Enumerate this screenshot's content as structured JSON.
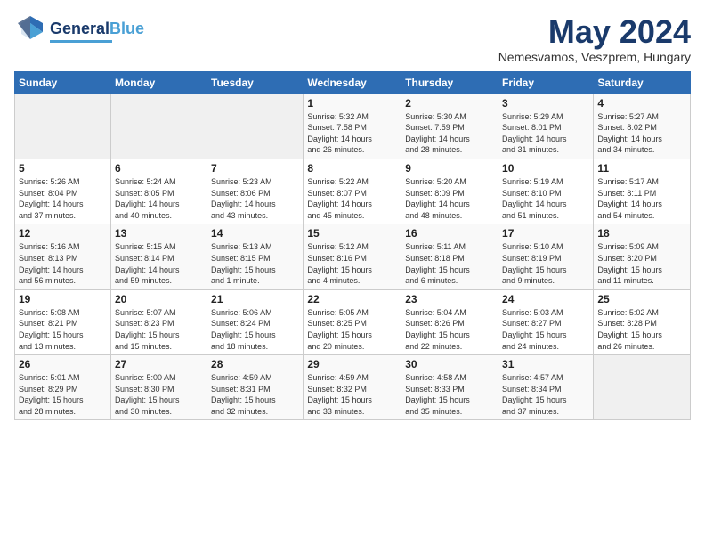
{
  "logo": {
    "line1": "General",
    "line2": "Blue"
  },
  "header": {
    "month": "May 2024",
    "location": "Nemesvamos, Veszprem, Hungary"
  },
  "weekdays": [
    "Sunday",
    "Monday",
    "Tuesday",
    "Wednesday",
    "Thursday",
    "Friday",
    "Saturday"
  ],
  "weeks": [
    [
      {
        "day": "",
        "info": ""
      },
      {
        "day": "",
        "info": ""
      },
      {
        "day": "",
        "info": ""
      },
      {
        "day": "1",
        "info": "Sunrise: 5:32 AM\nSunset: 7:58 PM\nDaylight: 14 hours\nand 26 minutes."
      },
      {
        "day": "2",
        "info": "Sunrise: 5:30 AM\nSunset: 7:59 PM\nDaylight: 14 hours\nand 28 minutes."
      },
      {
        "day": "3",
        "info": "Sunrise: 5:29 AM\nSunset: 8:01 PM\nDaylight: 14 hours\nand 31 minutes."
      },
      {
        "day": "4",
        "info": "Sunrise: 5:27 AM\nSunset: 8:02 PM\nDaylight: 14 hours\nand 34 minutes."
      }
    ],
    [
      {
        "day": "5",
        "info": "Sunrise: 5:26 AM\nSunset: 8:04 PM\nDaylight: 14 hours\nand 37 minutes."
      },
      {
        "day": "6",
        "info": "Sunrise: 5:24 AM\nSunset: 8:05 PM\nDaylight: 14 hours\nand 40 minutes."
      },
      {
        "day": "7",
        "info": "Sunrise: 5:23 AM\nSunset: 8:06 PM\nDaylight: 14 hours\nand 43 minutes."
      },
      {
        "day": "8",
        "info": "Sunrise: 5:22 AM\nSunset: 8:07 PM\nDaylight: 14 hours\nand 45 minutes."
      },
      {
        "day": "9",
        "info": "Sunrise: 5:20 AM\nSunset: 8:09 PM\nDaylight: 14 hours\nand 48 minutes."
      },
      {
        "day": "10",
        "info": "Sunrise: 5:19 AM\nSunset: 8:10 PM\nDaylight: 14 hours\nand 51 minutes."
      },
      {
        "day": "11",
        "info": "Sunrise: 5:17 AM\nSunset: 8:11 PM\nDaylight: 14 hours\nand 54 minutes."
      }
    ],
    [
      {
        "day": "12",
        "info": "Sunrise: 5:16 AM\nSunset: 8:13 PM\nDaylight: 14 hours\nand 56 minutes."
      },
      {
        "day": "13",
        "info": "Sunrise: 5:15 AM\nSunset: 8:14 PM\nDaylight: 14 hours\nand 59 minutes."
      },
      {
        "day": "14",
        "info": "Sunrise: 5:13 AM\nSunset: 8:15 PM\nDaylight: 15 hours\nand 1 minute."
      },
      {
        "day": "15",
        "info": "Sunrise: 5:12 AM\nSunset: 8:16 PM\nDaylight: 15 hours\nand 4 minutes."
      },
      {
        "day": "16",
        "info": "Sunrise: 5:11 AM\nSunset: 8:18 PM\nDaylight: 15 hours\nand 6 minutes."
      },
      {
        "day": "17",
        "info": "Sunrise: 5:10 AM\nSunset: 8:19 PM\nDaylight: 15 hours\nand 9 minutes."
      },
      {
        "day": "18",
        "info": "Sunrise: 5:09 AM\nSunset: 8:20 PM\nDaylight: 15 hours\nand 11 minutes."
      }
    ],
    [
      {
        "day": "19",
        "info": "Sunrise: 5:08 AM\nSunset: 8:21 PM\nDaylight: 15 hours\nand 13 minutes."
      },
      {
        "day": "20",
        "info": "Sunrise: 5:07 AM\nSunset: 8:23 PM\nDaylight: 15 hours\nand 15 minutes."
      },
      {
        "day": "21",
        "info": "Sunrise: 5:06 AM\nSunset: 8:24 PM\nDaylight: 15 hours\nand 18 minutes."
      },
      {
        "day": "22",
        "info": "Sunrise: 5:05 AM\nSunset: 8:25 PM\nDaylight: 15 hours\nand 20 minutes."
      },
      {
        "day": "23",
        "info": "Sunrise: 5:04 AM\nSunset: 8:26 PM\nDaylight: 15 hours\nand 22 minutes."
      },
      {
        "day": "24",
        "info": "Sunrise: 5:03 AM\nSunset: 8:27 PM\nDaylight: 15 hours\nand 24 minutes."
      },
      {
        "day": "25",
        "info": "Sunrise: 5:02 AM\nSunset: 8:28 PM\nDaylight: 15 hours\nand 26 minutes."
      }
    ],
    [
      {
        "day": "26",
        "info": "Sunrise: 5:01 AM\nSunset: 8:29 PM\nDaylight: 15 hours\nand 28 minutes."
      },
      {
        "day": "27",
        "info": "Sunrise: 5:00 AM\nSunset: 8:30 PM\nDaylight: 15 hours\nand 30 minutes."
      },
      {
        "day": "28",
        "info": "Sunrise: 4:59 AM\nSunset: 8:31 PM\nDaylight: 15 hours\nand 32 minutes."
      },
      {
        "day": "29",
        "info": "Sunrise: 4:59 AM\nSunset: 8:32 PM\nDaylight: 15 hours\nand 33 minutes."
      },
      {
        "day": "30",
        "info": "Sunrise: 4:58 AM\nSunset: 8:33 PM\nDaylight: 15 hours\nand 35 minutes."
      },
      {
        "day": "31",
        "info": "Sunrise: 4:57 AM\nSunset: 8:34 PM\nDaylight: 15 hours\nand 37 minutes."
      },
      {
        "day": "",
        "info": ""
      }
    ]
  ]
}
